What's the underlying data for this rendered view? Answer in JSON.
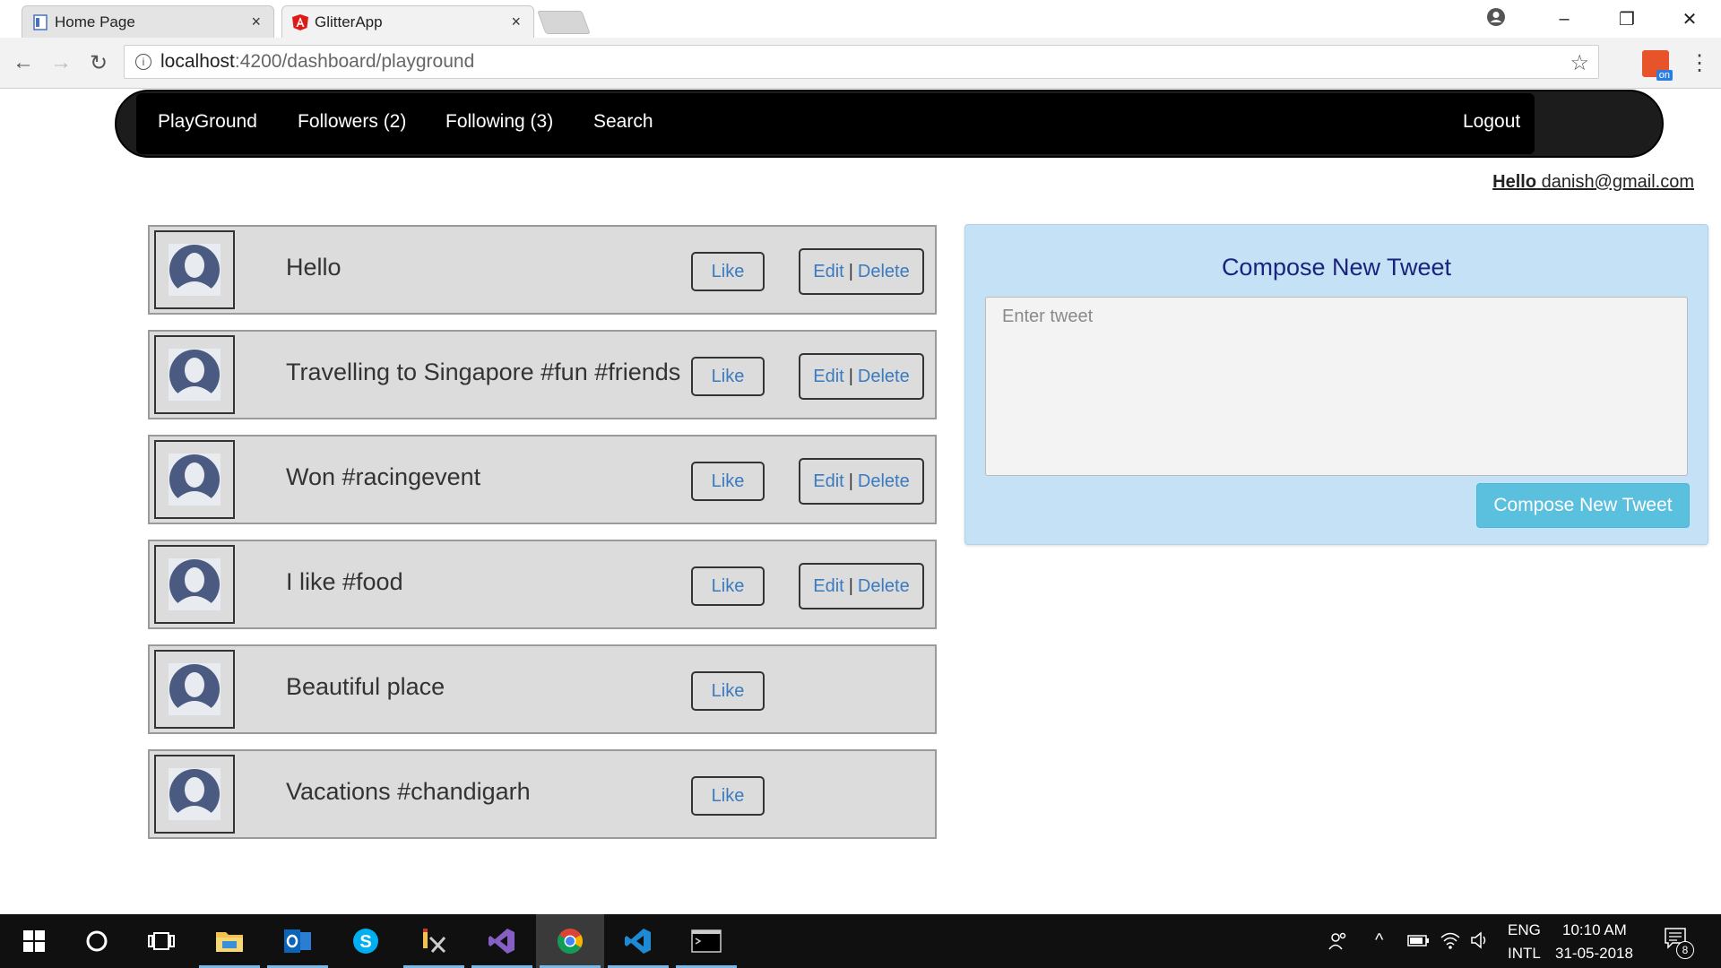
{
  "browser": {
    "tabs": [
      {
        "title": "Home Page",
        "icon": "document-icon",
        "active": false
      },
      {
        "title": "GlitterApp",
        "icon": "angular-icon",
        "active": true
      }
    ],
    "url_host": "localhost",
    "url_path": ":4200/dashboard/playground",
    "close_glyph": "×",
    "minimize_glyph": "–",
    "restore_glyph": "❐",
    "window_close_glyph": "✕",
    "back_glyph": "←",
    "forward_glyph": "→",
    "reload_glyph": "↻",
    "star_glyph": "☆",
    "menu_glyph": "⋮",
    "ext_badge": "on"
  },
  "nav": {
    "playground": "PlayGround",
    "followers": "Followers (2)",
    "following": "Following (3)",
    "search": "Search",
    "logout": "Logout"
  },
  "greeting": {
    "hello": "Hello",
    "email": "danish@gmail.com"
  },
  "tweets": [
    {
      "text": "Hello",
      "like": "Like",
      "edit": "Edit",
      "delete": "Delete",
      "sep": "|",
      "own": true
    },
    {
      "text": "Travelling to Singapore #fun #friends",
      "like": "Like",
      "edit": "Edit",
      "delete": "Delete",
      "sep": "|",
      "own": true
    },
    {
      "text": "Won #racingevent",
      "like": "Like",
      "edit": "Edit",
      "delete": "Delete",
      "sep": "|",
      "own": true
    },
    {
      "text": "I like #food",
      "like": "Like",
      "edit": "Edit",
      "delete": "Delete",
      "sep": "|",
      "own": true
    },
    {
      "text": "Beautiful place",
      "like": "Like",
      "own": false
    },
    {
      "text": "Vacations #chandigarh",
      "like": "Like",
      "own": false
    }
  ],
  "compose": {
    "title": "Compose New Tweet",
    "placeholder": "Enter tweet",
    "button": "Compose New Tweet"
  },
  "taskbar": {
    "lang_top": "ENG",
    "lang_bottom": "INTL",
    "time": "10:10 AM",
    "date": "31-05-2018",
    "notifications": "8"
  },
  "colors": {
    "nav_bg": "#000000",
    "link_blue": "#3a7abf",
    "compose_bg": "#c5e1f5",
    "compose_btn": "#5bc0de",
    "compose_title": "#1a237e"
  }
}
